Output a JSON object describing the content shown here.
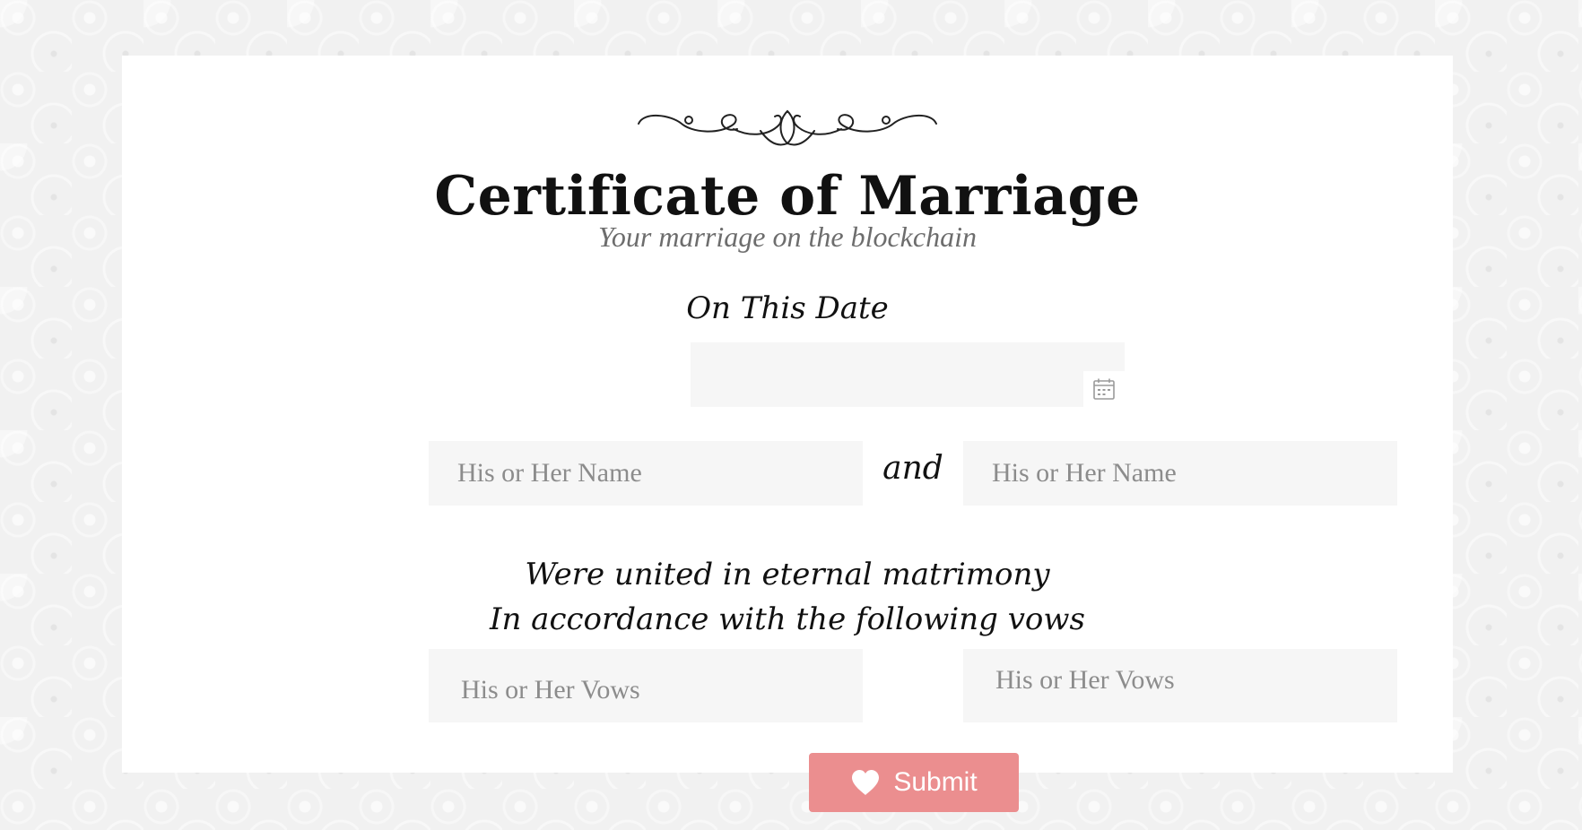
{
  "certificate": {
    "title": "Certificate of Marriage",
    "subtitle": "Your marriage on the blockchain",
    "date_label": "On This Date",
    "date_value": "",
    "name_placeholder_1": "His or Her Name",
    "connector": "and",
    "name_placeholder_2": "His or Her Name",
    "vows_intro_line1": "Were united in eternal matrimony",
    "vows_intro_line2": "In accordance with the following vows",
    "vows_placeholder_1": "His or Her Vows",
    "vows_placeholder_2": "His or Her Vows",
    "submit_label": "Submit"
  },
  "icons": {
    "ornament": "flourish-ornament-icon",
    "calendar": "calendar-icon",
    "submit": "heart-icon"
  },
  "colors": {
    "accent": "#eb8e8f",
    "field_background": "#f6f6f6",
    "placeholder": "#8c8c8c",
    "page_background": "#f1f1f1"
  }
}
